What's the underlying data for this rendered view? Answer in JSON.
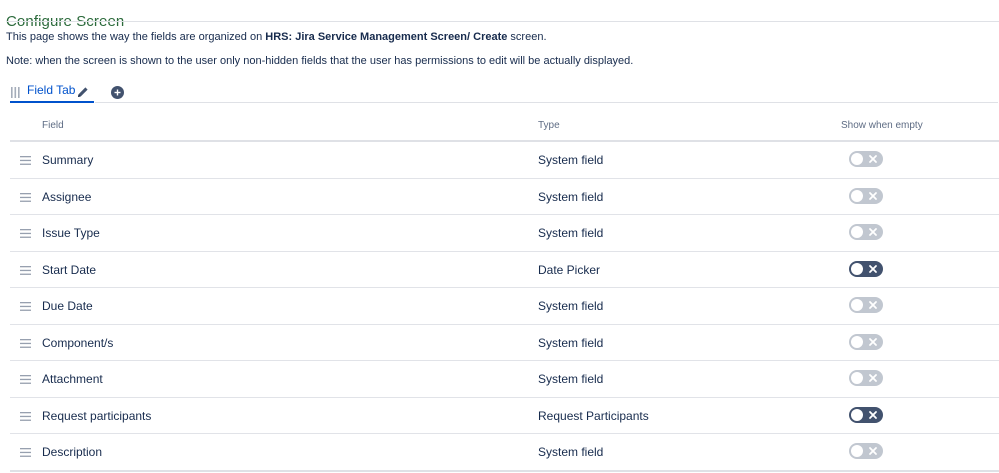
{
  "page": {
    "title": "Configure Screen",
    "desc1_prefix": "This page shows the way the fields are organized on ",
    "desc1_bold": "HRS: Jira Service Management Screen/ Create",
    "desc1_suffix": " screen.",
    "note": "Note: when the screen is shown to the user only non-hidden fields that the user has permissions to edit will be actually displayed."
  },
  "tabs": [
    {
      "label": "Field Tab",
      "active": true
    }
  ],
  "table": {
    "headers": {
      "field": "Field",
      "type": "Type",
      "show_when_empty": "Show when empty"
    },
    "rows": [
      {
        "field": "Summary",
        "type": "System field",
        "show_when_empty": false
      },
      {
        "field": "Assignee",
        "type": "System field",
        "show_when_empty": false
      },
      {
        "field": "Issue Type",
        "type": "System field",
        "show_when_empty": false
      },
      {
        "field": "Start Date",
        "type": "Date Picker",
        "show_when_empty": false,
        "enabled_style": "dark"
      },
      {
        "field": "Due Date",
        "type": "System field",
        "show_when_empty": false
      },
      {
        "field": "Component/s",
        "type": "System field",
        "show_when_empty": false
      },
      {
        "field": "Attachment",
        "type": "System field",
        "show_when_empty": false
      },
      {
        "field": "Request participants",
        "type": "Request Participants",
        "show_when_empty": false,
        "enabled_style": "dark"
      },
      {
        "field": "Description",
        "type": "System field",
        "show_when_empty": false
      }
    ]
  },
  "colors": {
    "title": "#2b6a3b",
    "accent": "#0052cc",
    "toggle_light": "#c1c7d0",
    "toggle_dark": "#42526e"
  },
  "icons": {
    "tab_drag": "drag-handle-icon",
    "tab_edit": "pencil-icon",
    "add_tab": "plus-circle-icon",
    "row_drag": "drag-handle-icon",
    "toggle_mark": "close-icon"
  }
}
